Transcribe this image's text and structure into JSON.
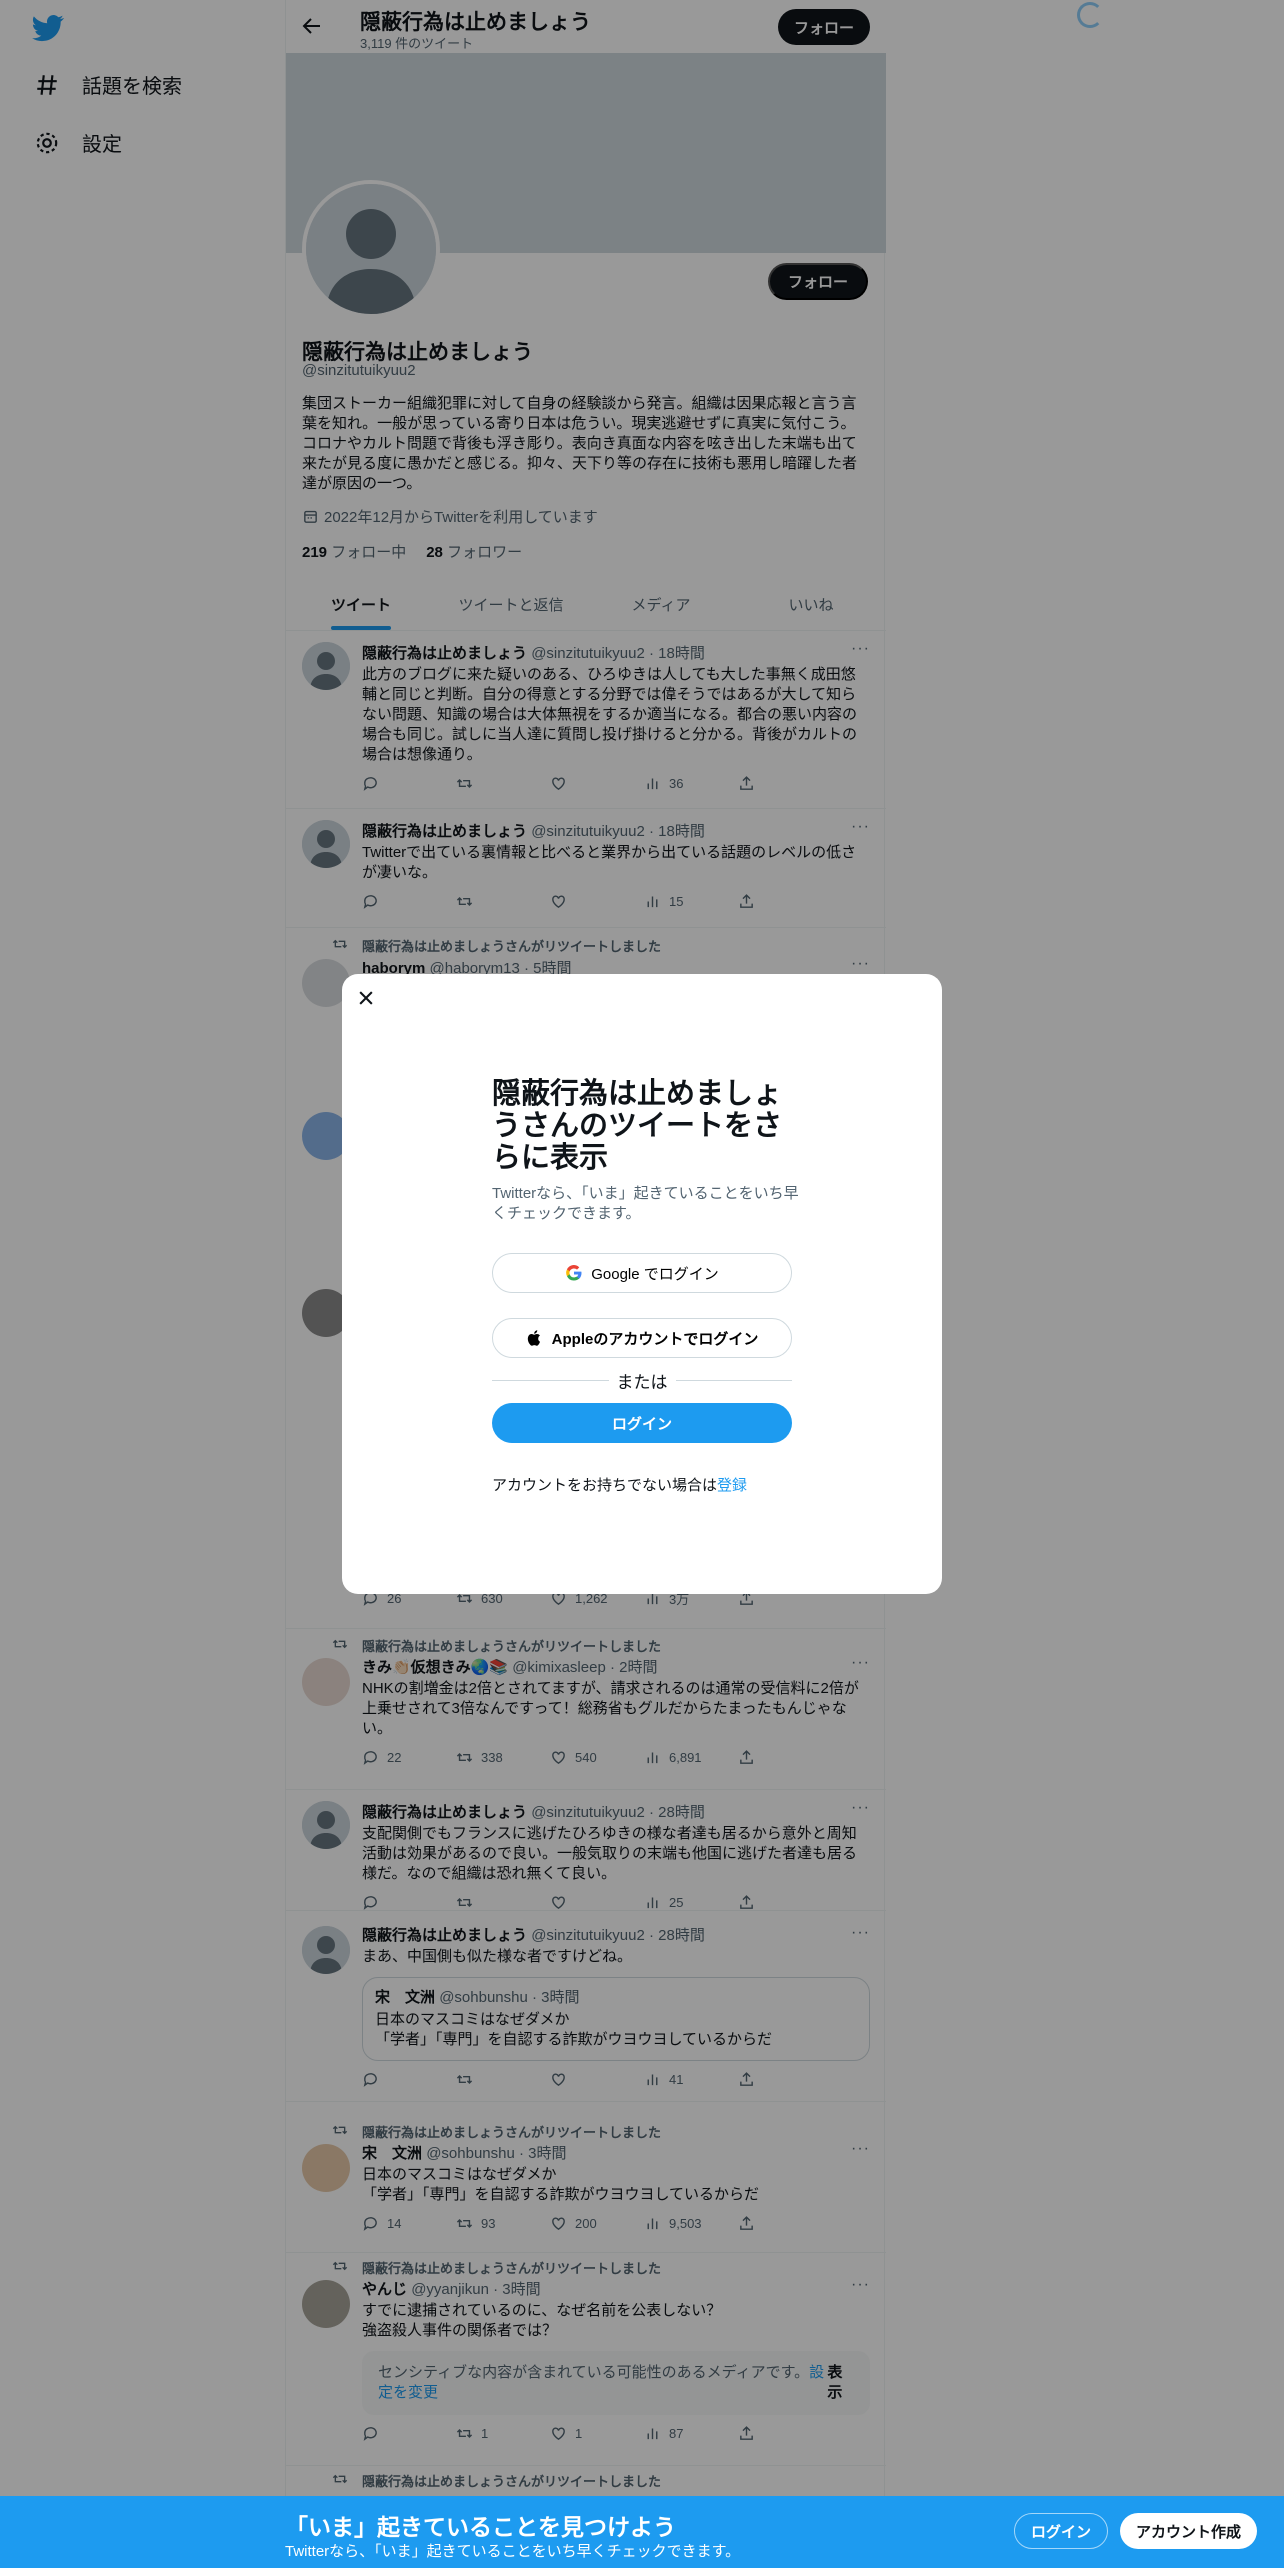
{
  "sidebar": {
    "items": [
      {
        "label": "話題を検索"
      },
      {
        "label": "設定"
      }
    ]
  },
  "header": {
    "title": "隠蔽行為は止めましょう",
    "tweet_count": "3,119 件のツイート",
    "follow_label": "フォロー"
  },
  "profile": {
    "name": "隠蔽行為は止めましょう",
    "handle": "@sinzitutuikyuu2",
    "bio": "集団ストーカー組織犯罪に対して自身の経験談から発言。組織は因果応報と言う言葉を知れ。一般が思っている寄り日本は危うい。現実逃避せずに真実に気付こう。コロナやカルト問題で背後も浮き彫り。表向き真面な内容を呟き出した末端も出て来たが見る度に愚かだと感じる。抑々、天下り等の存在に技術も悪用し暗躍した者達が原因の一つ。",
    "joined": "2022年12月からTwitterを利用しています",
    "following_count": "219",
    "following_label": "フォロー中",
    "followers_count": "28",
    "followers_label": "フォロワー",
    "follow_label": "フォロー"
  },
  "tabs": [
    {
      "label": "ツイート"
    },
    {
      "label": "ツイートと返信"
    },
    {
      "label": "メディア"
    },
    {
      "label": "いいね"
    }
  ],
  "tweets": {
    "t1": {
      "name": "隠蔽行為は止めましょう",
      "meta": "@sinzitutuikyuu2 · 18時間",
      "text": "此方のブログに来た疑いのある、ひろゆきは人しても大した事無く成田悠輔と同じと判断。自分の得意とする分野では偉そうではあるが大して知らない問題、知識の場合は大体無視をするか適当になる。都合の悪い内容の場合も同じ。試しに当人達に質問し投げ掛けると分かる。背後がカルトの場合は想像通り。",
      "views": "36"
    },
    "t2": {
      "name": "隠蔽行為は止めましょう",
      "meta": "@sinzitutuikyuu2 · 18時間",
      "text": "Twitterで出ている裏情報と比べると業界から出ている話題のレベルの低さが凄いな。",
      "views": "15"
    },
    "t3": {
      "rt": "隠蔽行為は止めましょうさんがリツイートしました",
      "name": "haborym",
      "meta": "@haborym13 · 5時間"
    },
    "t3b": {
      "replies": "26",
      "retweets": "630",
      "likes": "1,262",
      "views": "3万"
    },
    "t4": {
      "rt": "隠蔽行為は止めましょうさんがリツイートしました",
      "name": "きみ👏🏻仮想きみ🌏📚",
      "meta": "@kimixasleep · 2時間",
      "text": "NHKの割増金は2倍とされてますが、請求されるのは通常の受信料に2倍が上乗せされて3倍なんですって！総務省もグルだからたまったもんじゃない。",
      "replies": "22",
      "retweets": "338",
      "likes": "540",
      "views": "6,891"
    },
    "t5": {
      "name": "隠蔽行為は止めましょう",
      "meta": "@sinzitutuikyuu2 · 28時間",
      "text": "支配関側でもフランスに逃げたひろゆきの様な者達も居るから意外と周知活動は効果があるので良い。一般気取りの末端も他国に逃げた者達も居る様だ。なので組織は恐れ無くて良い。",
      "views": "25"
    },
    "t6": {
      "name": "隠蔽行為は止めましょう",
      "meta": "@sinzitutuikyuu2 · 28時間",
      "text": "まあ、中国側も似た様な者ですけどね。",
      "quote_name": "宋　文洲",
      "quote_meta": "@sohbunshu · 3時間",
      "quote_text": "日本のマスコミはなぜダメか\n「学者」「専門」を自認する詐欺がウヨウヨしているからだ",
      "views": "41"
    },
    "t7": {
      "rt": "隠蔽行為は止めましょうさんがリツイートしました",
      "name": "宋　文洲",
      "meta": "@sohbunshu · 3時間",
      "text": "日本のマスコミはなぜダメか\n「学者」「専門」を自認する詐欺がウヨウヨしているからだ",
      "replies": "14",
      "retweets": "93",
      "likes": "200",
      "views": "9,503"
    },
    "t8": {
      "rt": "隠蔽行為は止めましょうさんがリツイートしました",
      "name": "やんじ",
      "meta": "@yyanjikun · 3時間",
      "text": "すでに逮捕されているのに、なぜ名前を公表しない？\n強盗殺人事件の関係者では？",
      "sensitive_text": "センシティブな内容が含まれている可能性のあるメディアです。",
      "sensitive_link": "設定を変更",
      "sensitive_show": "表示",
      "retweets": "1",
      "likes": "1",
      "views": "87"
    },
    "t9": {
      "rt": "隠蔽行為は止めましょうさんがリツイートしました"
    }
  },
  "modal": {
    "title": "隠蔽行為は止めましょうさんのツイートをさらに表示",
    "subtitle": "Twitterなら、「いま」起きていることをいち早くチェックできます。",
    "google_label": "Google でログイン",
    "apple_label": "Appleのアカウントでログイン",
    "or_label": "または",
    "login_label": "ログイン",
    "signup_prefix": "アカウントをお持ちでない場合は",
    "signup_link": "登録"
  },
  "bottom_bar": {
    "title": "「いま」起きていることを見つけよう",
    "subtitle": "Twitterなら、「いま」起きていることをいち早くチェックできます。",
    "login_label": "ログイン",
    "signup_label": "アカウント作成"
  },
  "colors": {
    "accent": "#1d9bf0",
    "text": "#0f1419",
    "secondary": "#536471"
  }
}
